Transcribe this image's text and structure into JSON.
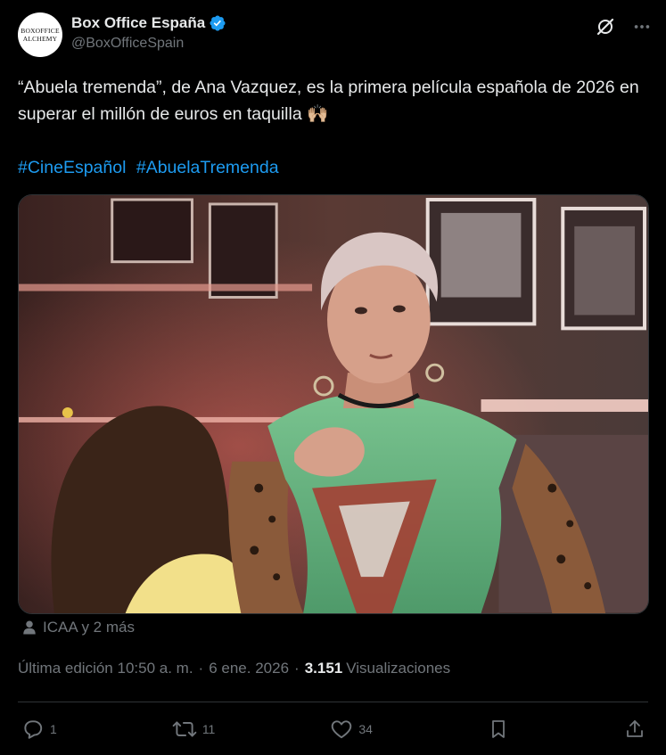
{
  "account": {
    "avatar_line1": "BOXOFFICE",
    "avatar_line2": "ALCHEMY",
    "name": "Box Office España",
    "handle": "@BoxOfficeSpain"
  },
  "tweet": {
    "text": "“Abuela tremenda”, de Ana Vazquez, es la primera película española de 2026 en superar el millón de euros en taquilla 🙌🏼",
    "hashtags": [
      "#CineEspañol",
      "#AbuelaTremenda"
    ]
  },
  "media": {
    "tagged": "ICAA y 2 más"
  },
  "meta": {
    "edited": "Última edición 10:50 a. m.",
    "separator": "·",
    "date": "6 ene. 2026",
    "views_count": "3.151",
    "views_label": "Visualizaciones"
  },
  "actions": {
    "replies": "1",
    "reposts": "11",
    "likes": "34"
  },
  "colors": {
    "background": "#000000",
    "text": "#e7e9ea",
    "secondary": "#71767b",
    "link": "#1d9bf0",
    "verified": "#1d9bf0"
  },
  "icons": [
    "verified-icon",
    "grok-icon",
    "more-icon",
    "person-icon",
    "reply-icon",
    "repost-icon",
    "like-icon",
    "bookmark-icon",
    "share-icon"
  ]
}
